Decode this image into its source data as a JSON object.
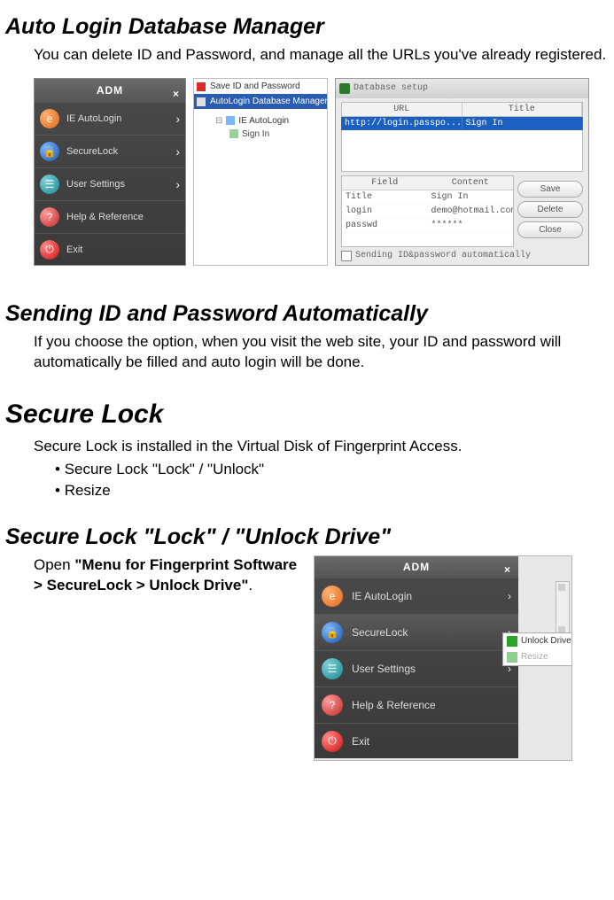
{
  "section1": {
    "title": "Auto Login Database Manager",
    "desc": "You can delete ID and Password, and manage all the URLs you've already registered."
  },
  "adm": {
    "title": "ADM",
    "items": [
      {
        "label": "IE AutoLogin",
        "icon": "ic-orange",
        "arrow": true
      },
      {
        "label": "SecureLock",
        "icon": "ic-blue",
        "arrow": true
      },
      {
        "label": "User Settings",
        "icon": "ic-teal",
        "arrow": true
      },
      {
        "label": "Help & Reference",
        "icon": "ic-ask",
        "arrow": false
      },
      {
        "label": "Exit",
        "icon": "ic-red",
        "arrow": false
      }
    ]
  },
  "ctx": {
    "save": "Save ID and Password",
    "aldm": "AutoLogin Database Manager",
    "tree_root": "IE AutoLogin",
    "tree_child": "Sign In"
  },
  "db": {
    "title": "Database setup",
    "head_url": "URL",
    "head_title": "Title",
    "row_url": "http://login.passpo...",
    "row_title": "Sign In",
    "grid_head_field": "Field",
    "grid_head_content": "Content",
    "rows": [
      {
        "field": "Title",
        "content": "Sign In"
      },
      {
        "field": "login",
        "content": "demo@hotmail.com"
      },
      {
        "field": "passwd",
        "content": "******"
      }
    ],
    "btn_save": "Save",
    "btn_delete": "Delete",
    "btn_close": "Close",
    "foot": "Sending ID&password automatically"
  },
  "section2": {
    "title": "Sending ID and Password Automatically",
    "desc": "If you choose the option, when you visit the web site, your ID and password will automatically be filled and auto login will be done."
  },
  "section3": {
    "title": "Secure Lock",
    "desc": "Secure Lock is installed in the Virtual Disk of Fingerprint Access.",
    "li1": "Secure Lock \"Lock\" / \"Unlock\"",
    "li2": "Resize"
  },
  "section4": {
    "title": "Secure Lock \"Lock\" / \"Unlock Drive\"",
    "open_pre": "Open ",
    "open_bold": "\"Menu for Fingerprint Software > SecureLock > Unlock Drive\"",
    "open_post": "."
  },
  "fly": {
    "unlock": "Unlock Drive",
    "resize": "Resize"
  }
}
